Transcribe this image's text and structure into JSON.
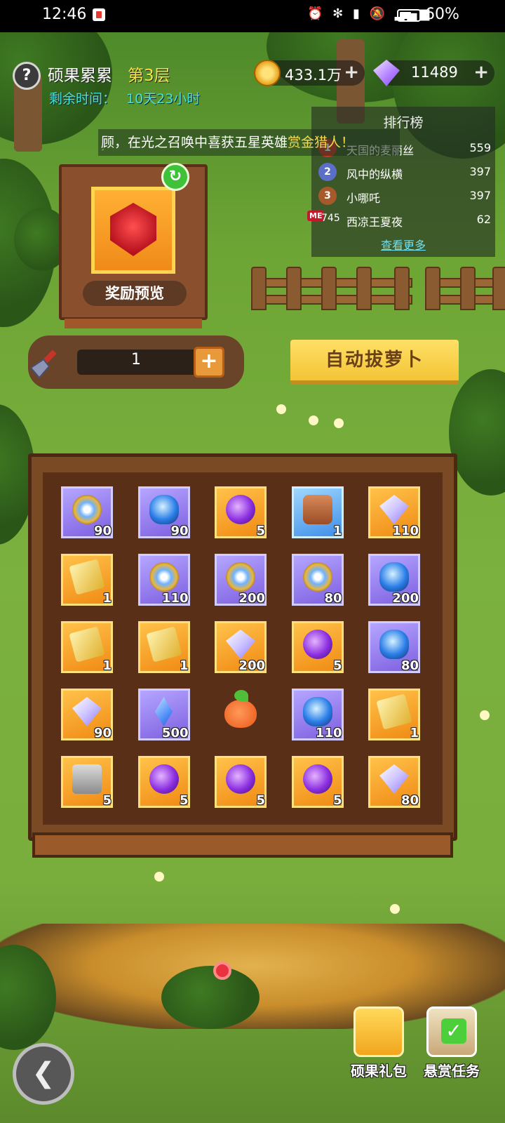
{
  "status_bar": {
    "time": "12:46",
    "icons": "⏰ ✻ ▮ 🔕 ▂▄▆",
    "battery_pct": "60%",
    "battery_level": 0.6
  },
  "hud": {
    "help_icon": "?",
    "level_name": "硕果累累",
    "floor": "第3层",
    "time_label": "剩余时间：",
    "time_value": "10天23小时",
    "gold": "433.1万",
    "gems": "11489",
    "plus_icon": "+"
  },
  "ticker": {
    "text_prefix": "ؚ顾，在光之召唤中喜获五星英雄",
    "hero": "赏金猎人！"
  },
  "ranking": {
    "title": "排行榜",
    "rows": [
      {
        "rank": "1",
        "name": "天国的麦丽丝",
        "score": "559"
      },
      {
        "rank": "2",
        "name": "风中的纵横",
        "score": "397"
      },
      {
        "rank": "3",
        "name": "小哪吒",
        "score": "397"
      },
      {
        "rank": "745",
        "name": "西凉王夏夜",
        "score": "62",
        "me": "ME"
      }
    ],
    "more": "查看更多"
  },
  "reward": {
    "label": "奖励预览",
    "refresh_icon": "↻"
  },
  "shovel": {
    "count": "1",
    "plus": "+"
  },
  "auto_button": "自动拔萝卜",
  "board": {
    "cells": [
      {
        "bg": "purple",
        "icon": "coin",
        "qty": "90"
      },
      {
        "bg": "purple",
        "icon": "egg",
        "qty": "90"
      },
      {
        "bg": "orange",
        "icon": "orb",
        "qty": "5"
      },
      {
        "bg": "blue",
        "icon": "treasure",
        "qty": "1"
      },
      {
        "bg": "orange",
        "icon": "diamond",
        "qty": "110"
      },
      {
        "bg": "orange",
        "icon": "ticket",
        "qty": "1"
      },
      {
        "bg": "purple",
        "icon": "coin",
        "qty": "110"
      },
      {
        "bg": "purple",
        "icon": "coin",
        "qty": "200"
      },
      {
        "bg": "purple",
        "icon": "coin",
        "qty": "80"
      },
      {
        "bg": "purple",
        "icon": "egg",
        "qty": "200"
      },
      {
        "bg": "orange",
        "icon": "ticket",
        "qty": "1"
      },
      {
        "bg": "orange",
        "icon": "ticket",
        "qty": "1"
      },
      {
        "bg": "orange",
        "icon": "diamond",
        "qty": "200"
      },
      {
        "bg": "orange",
        "icon": "orb",
        "qty": "5"
      },
      {
        "bg": "purple",
        "icon": "egg",
        "qty": "80"
      },
      {
        "bg": "orange",
        "icon": "diamond",
        "qty": "90"
      },
      {
        "bg": "purple",
        "icon": "crystal",
        "qty": "500"
      },
      {
        "bg": "plain",
        "icon": "carrot",
        "qty": ""
      },
      {
        "bg": "purple",
        "icon": "egg",
        "qty": "110"
      },
      {
        "bg": "orange",
        "icon": "ticket",
        "qty": "1"
      },
      {
        "bg": "orange",
        "icon": "chest",
        "qty": "5"
      },
      {
        "bg": "orange",
        "icon": "orb",
        "qty": "5"
      },
      {
        "bg": "orange",
        "icon": "orb",
        "qty": "5"
      },
      {
        "bg": "orange",
        "icon": "orb",
        "qty": "5"
      },
      {
        "bg": "orange",
        "icon": "diamond",
        "qty": "80"
      }
    ]
  },
  "bottom": {
    "back_icon": "❮",
    "gift_label": "硕果礼包",
    "task_label": "悬赏任务",
    "task_check": "✓"
  }
}
